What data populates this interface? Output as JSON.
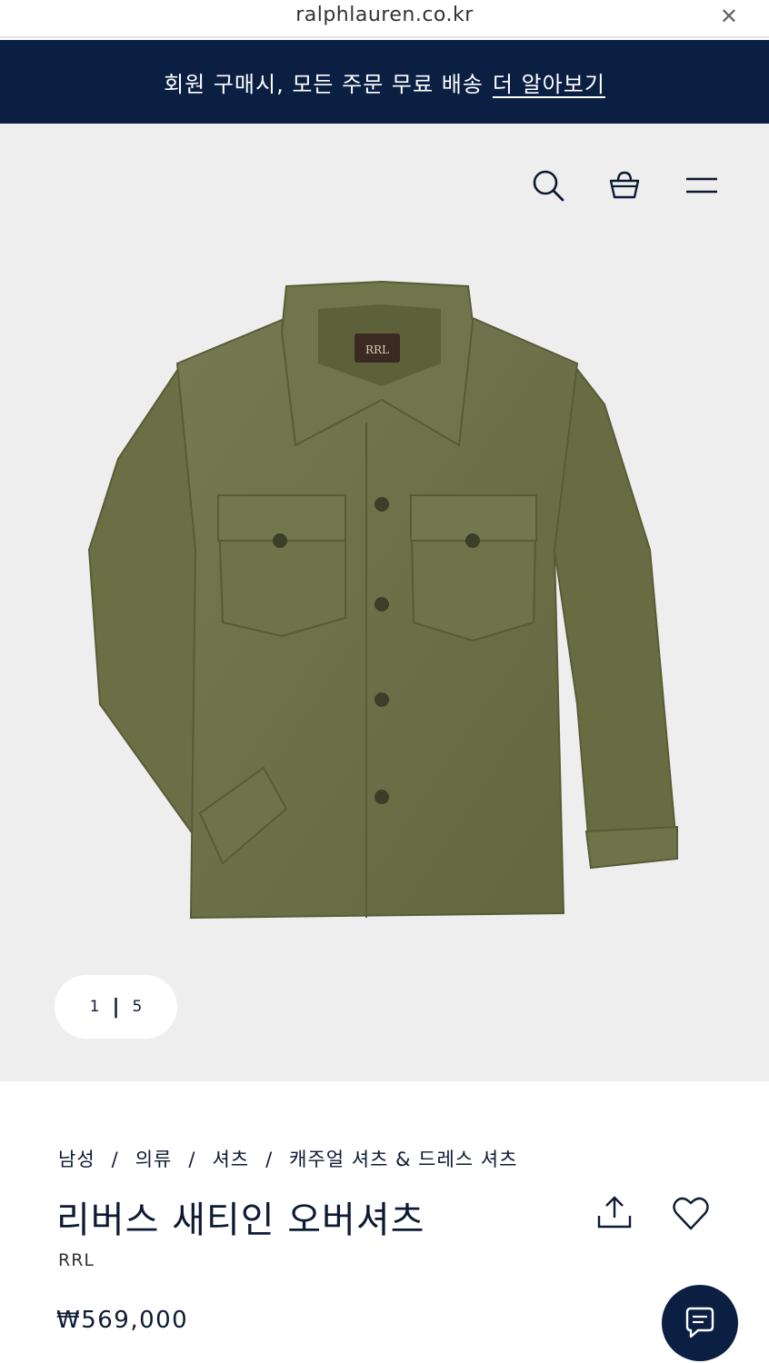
{
  "browser": {
    "url": "ralphlauren.co.kr",
    "close_label": "✕"
  },
  "promo": {
    "text": "회원 구매시, 모든 주문 무료 배송",
    "link": "더 알아보기"
  },
  "header_icons": [
    "search-icon",
    "shopping-bag-icon",
    "menu-icon"
  ],
  "gallery": {
    "current": "1",
    "separator": "|",
    "total": "5"
  },
  "breadcrumb": [
    "남성",
    "의류",
    "셔츠",
    "캐주얼 셔츠 & 드레스 셔츠"
  ],
  "product": {
    "title": "리버스 새티인 오버셔츠",
    "brand": "RRL",
    "price": "₩569,000"
  },
  "colors": {
    "navy": "#0b1f43",
    "image_bg": "#efeeee",
    "shirt": "#6b7048"
  }
}
